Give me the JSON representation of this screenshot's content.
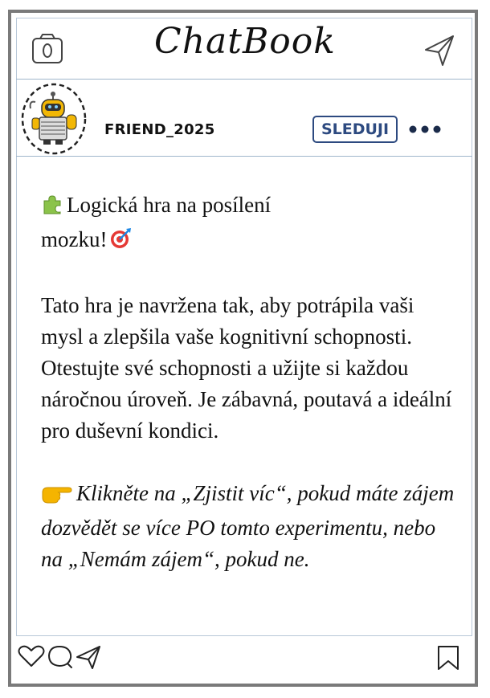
{
  "app": {
    "title": "ChatBook"
  },
  "header": {
    "camera_icon": "camera-icon",
    "send_icon": "paper-plane-icon"
  },
  "profile": {
    "username": "FRIEND_2025",
    "follow_label": "SLEDUJI",
    "more_icon": "more-dots-icon"
  },
  "post": {
    "headline": "Logická hra na posílení mozku!",
    "headline_icons": [
      "puzzle-piece-icon",
      "target-icon"
    ],
    "body": "Tato hra je navržena tak, aby potrápila vaši mysl a zlepšila vaše kognitivní schopnosti. Otestujte své schopnosti a užijte si každou náročnou úroveň. Je zábavná, poutavá a ideální pro duševní kondici.",
    "cta": "Klikněte na „Zjistit víc“, pokud máte zájem dozvědět se více PO tomto experimentu, nebo na „Nemám zájem“, pokud ne.",
    "cta_icon": "pointing-hand-icon"
  },
  "actions": {
    "icons": [
      "heart-icon",
      "comment-icon",
      "share-icon",
      "bookmark-icon"
    ]
  },
  "colors": {
    "frame": "#7a7a7a",
    "divider": "#9fb6cc",
    "follow_accent": "#2d4a80",
    "puzzle": "#8bc34a",
    "hand": "#f5b400"
  }
}
